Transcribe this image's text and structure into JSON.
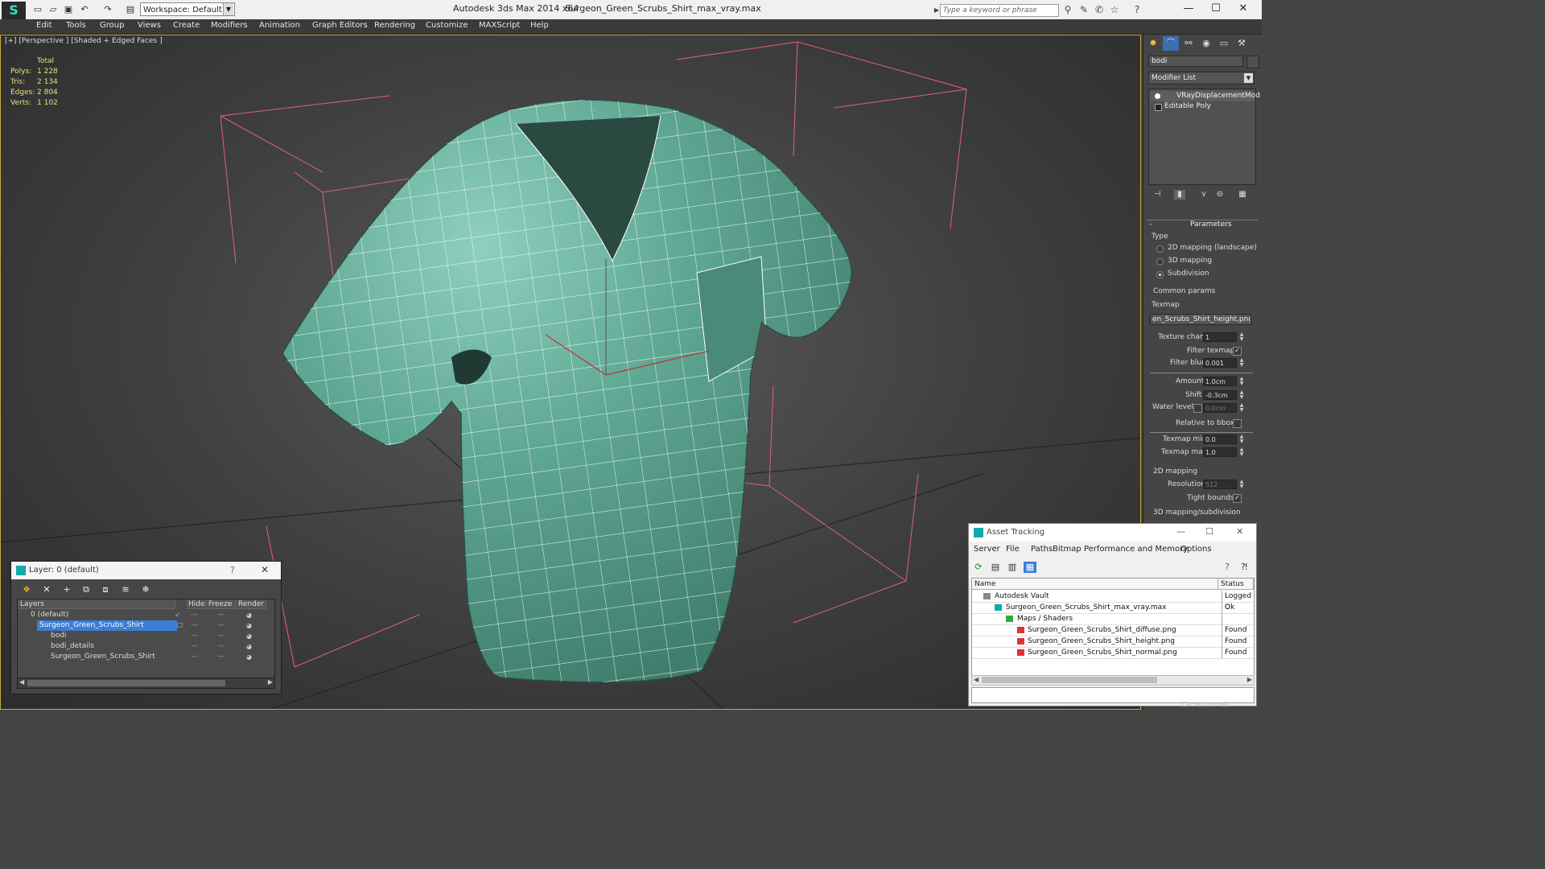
{
  "titlebar": {
    "logo": "S",
    "workspace": "Workspace: Default",
    "app_title": "Autodesk 3ds Max 2014 x64",
    "file_title": "Surgeon_Green_Scrubs_Shirt_max_vray.max",
    "search_placeholder": "Type a keyword or phrase"
  },
  "menu": [
    "Edit",
    "Tools",
    "Group",
    "Views",
    "Create",
    "Modifiers",
    "Animation",
    "Graph Editors",
    "Rendering",
    "Customize",
    "MAXScript",
    "Help"
  ],
  "viewport": {
    "label": "[+] [Perspective ] [Shaded + Edged Faces ]",
    "stats": {
      "header": "Total",
      "rows": [
        {
          "label": "Polys:",
          "value": "1 228"
        },
        {
          "label": "Tris:",
          "value": "2 134"
        },
        {
          "label": "Edges:",
          "value": "2 804"
        },
        {
          "label": "Verts:",
          "value": "1 102"
        }
      ]
    },
    "mesh_color": "#5fa893",
    "bbox_color": "#e0607a"
  },
  "command_panel": {
    "object_name": "bodi",
    "modifier_list": "Modifier List",
    "stack": [
      "VRayDisplacementMod",
      "Editable Poly"
    ],
    "parameters": {
      "rollout": "Parameters",
      "type_group": "Type",
      "types": [
        "2D mapping (landscape)",
        "3D mapping",
        "Subdivision"
      ],
      "selected_type": "Subdivision",
      "common_group": "Common params",
      "texmap_label": "Texmap",
      "texmap_value": "en_Scrubs_Shirt_height.png)",
      "texture_chan_label": "Texture chan",
      "texture_chan_value": "1",
      "filter_texmap_label": "Filter texmap",
      "filter_blur_label": "Filter blur",
      "filter_blur_value": "0.001",
      "amount_label": "Amount",
      "amount_value": "1.0cm",
      "shift_label": "Shift",
      "shift_value": "-0.3cm",
      "water_level_label": "Water level",
      "water_level_value": "0.0cm",
      "relative_bbox_label": "Relative to bbox",
      "texmap_min_label": "Texmap min",
      "texmap_min_value": "0.0",
      "texmap_max_label": "Texmap max",
      "texmap_max_value": "1.0",
      "mapping_2d_group": "2D mapping",
      "resolution_label": "Resolution",
      "resolution_value": "512",
      "tight_bounds_label": "Tight bounds",
      "mapping_3d_group": "3D mapping/subdivision"
    }
  },
  "layer_window": {
    "title": "Layer: 0 (default)",
    "help": "?",
    "columns": [
      "Layers",
      "Hide",
      "Freeze",
      "Render"
    ],
    "rows": [
      {
        "name": "0 (default)",
        "indent": 0
      },
      {
        "name": "Surgeon_Green_Scrubs_Shirt",
        "indent": 0,
        "selected": true
      },
      {
        "name": "bodi",
        "indent": 1
      },
      {
        "name": "bodi_details",
        "indent": 1
      },
      {
        "name": "Surgeon_Green_Scrubs_Shirt",
        "indent": 1
      }
    ]
  },
  "asset_window": {
    "title": "Asset Tracking",
    "menu": [
      "Server",
      "File",
      "Paths",
      "Bitmap Performance and Memory",
      "Options"
    ],
    "columns": [
      "Name",
      "Status"
    ],
    "rows": [
      {
        "name": "Autodesk Vault",
        "status": "Logged O",
        "indent": 0
      },
      {
        "name": "Surgeon_Green_Scrubs_Shirt_max_vray.max",
        "status": "Ok",
        "indent": 1
      },
      {
        "name": "Maps / Shaders",
        "status": "",
        "indent": 2
      },
      {
        "name": "Surgeon_Green_Scrubs_Shirt_diffuse.png",
        "status": "Found",
        "indent": 3
      },
      {
        "name": "Surgeon_Green_Scrubs_Shirt_height.png",
        "status": "Found",
        "indent": 3
      },
      {
        "name": "Surgeon_Green_Scrubs_Shirt_normal.png",
        "status": "Found",
        "indent": 3
      }
    ]
  },
  "status": {
    "cache_normals": "Cache normals"
  }
}
